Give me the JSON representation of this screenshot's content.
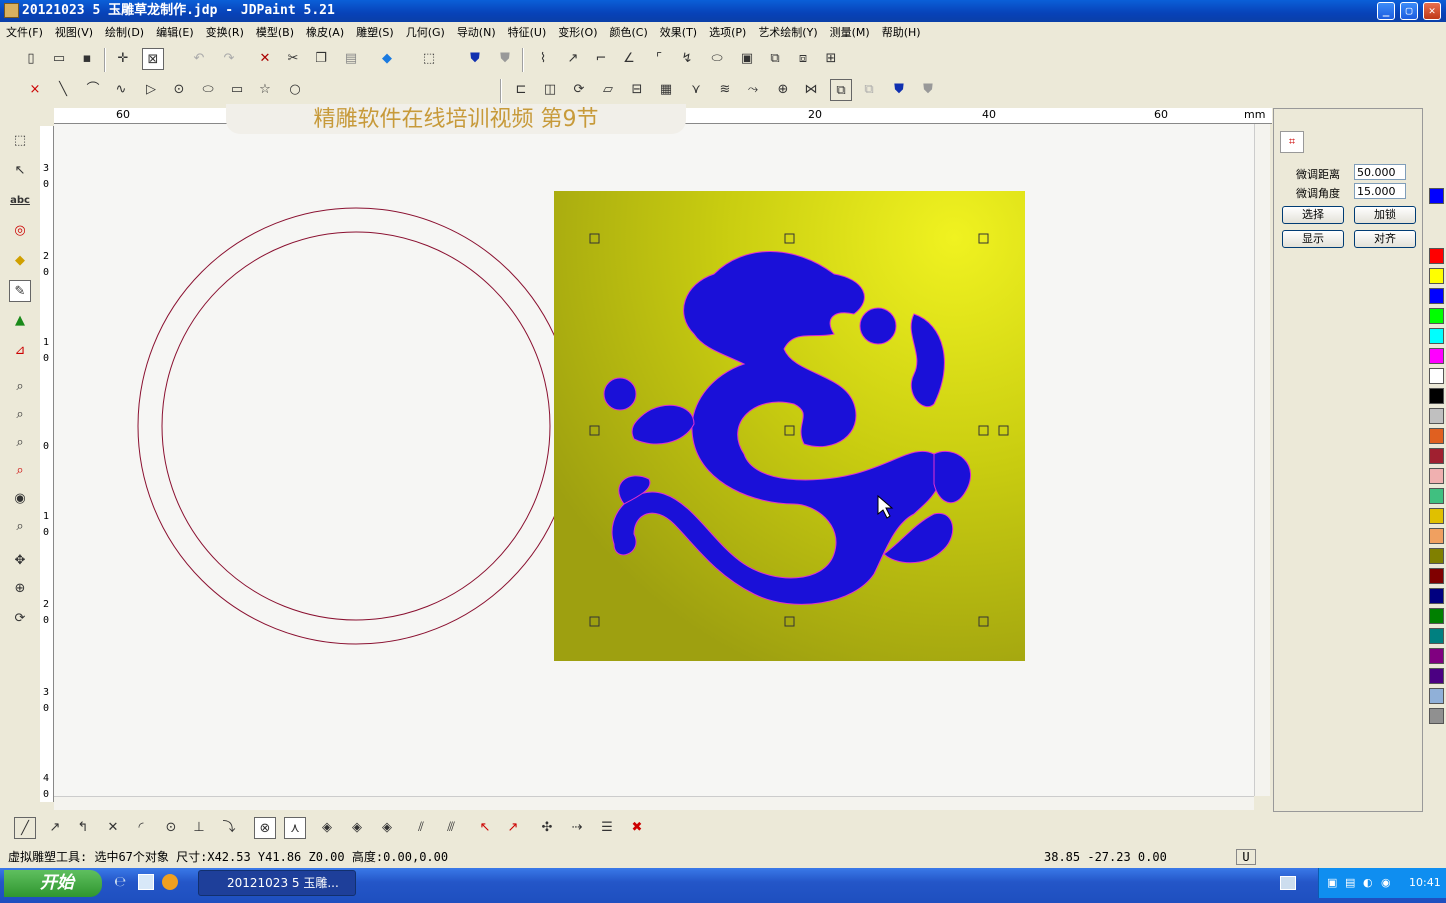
{
  "window": {
    "title": "20121023 5 玉雕草龙制作.jdp - JDPaint 5.21",
    "min": "_",
    "max": "▢",
    "close": "✕"
  },
  "menu": [
    "文件(F)",
    "视图(V)",
    "绘制(D)",
    "编辑(E)",
    "变换(R)",
    "模型(B)",
    "橡皮(A)",
    "雕塑(S)",
    "几何(G)",
    "导动(N)",
    "特征(U)",
    "变形(O)",
    "颜色(C)",
    "效果(T)",
    "选项(P)",
    "艺术绘制(Y)",
    "测量(M)",
    "帮助(H)"
  ],
  "banner": "精雕软件在线培训视频   第9节",
  "hruler": {
    "t60a": "60",
    "t20": "20",
    "t40": "40",
    "t60b": "60",
    "unit": "mm"
  },
  "vruler": [
    "3",
    "0",
    "2",
    "0",
    "1",
    "0",
    "0",
    "1",
    "0",
    "2",
    "0",
    "3",
    "0",
    "4",
    "0"
  ],
  "panel": {
    "dist_label": "微调距离",
    "dist_value": "50.000",
    "angle_label": "微调角度",
    "angle_value": "15.000",
    "select": "选择",
    "lock": "加锁",
    "show": "显示",
    "align": "对齐"
  },
  "palette": [
    "#0000ff",
    "#ff0000",
    "#ffff00",
    "#0000ff",
    "#00ff00",
    "#00ffff",
    "#ff00ff",
    "#ffffff",
    "#000000",
    "#c0c0c0",
    "#e06020",
    "#a02030",
    "#f0b0b0",
    "#40c080",
    "#e0c000",
    "#f0a060",
    "#808000",
    "#800000",
    "#000080",
    "#008000",
    "#008080",
    "#800080",
    "#4b0082",
    "#90b0d8",
    "#909090"
  ],
  "status": {
    "left": "虚拟雕塑工具: 选中67个对象 尺寸:X42.53 Y41.86 Z0.00 高度:0.00,0.00",
    "coords": "38.85 -27.23 0.00",
    "mode": "U"
  },
  "taskbar": {
    "start": "开始",
    "task": "20121023 5 玉雕...",
    "time": "10:41"
  }
}
